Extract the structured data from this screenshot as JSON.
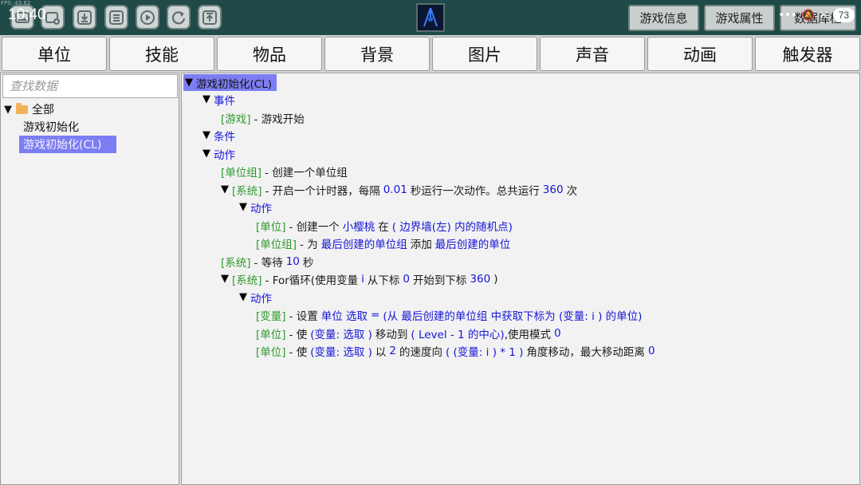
{
  "status": {
    "fps": "FPS: 43.82",
    "clock": "10:40",
    "battery": "73"
  },
  "toolbar": {
    "buttons": [
      "image-icon",
      "add-file-icon",
      "download-icon",
      "save-icon",
      "play-icon",
      "refresh-icon",
      "upload-icon"
    ],
    "pills": [
      "游戏信息",
      "游戏属性",
      "数据库检"
    ]
  },
  "tabs": [
    "单位",
    "技能",
    "物品",
    "背景",
    "图片",
    "声音",
    "动画",
    "触发器"
  ],
  "left": {
    "search_placeholder": "查找数据",
    "root_label": "全部",
    "items": [
      "游戏初始化",
      "游戏初始化(CL)"
    ]
  },
  "script": {
    "root": "游戏初始化(CL)",
    "events_header": "事件",
    "event": {
      "tag": "[游戏]",
      "text": "- 游戏开始"
    },
    "conditions_header": "条件",
    "actions_header": "动作",
    "a1": {
      "tag": "[单位组]",
      "text": "- 创建一个单位组"
    },
    "a2": {
      "tag": "[系统]",
      "t1": "- 开启一个计时器，每隔",
      "v1": "0.01",
      "t2": "秒运行一次动作。总共运行",
      "v2": "360",
      "t3": "次"
    },
    "a2_actions": "动作",
    "a2_1": {
      "tag": "[单位]",
      "t1": "- 创建一个",
      "v1": "小樱桃",
      "t2": "在",
      "v2": "( 边界墙(左) 内的随机点)"
    },
    "a2_2": {
      "tag": "[单位组]",
      "t1": "- 为",
      "v1": "最后创建的单位组",
      "t2": "添加",
      "v2": "最后创建的单位"
    },
    "a3": {
      "tag": "[系统]",
      "t1": "- 等待",
      "v1": "10",
      "t2": "秒"
    },
    "a4": {
      "tag": "[系统]",
      "t1": "- For循环(使用变量",
      "v1": "i",
      "t2": "从下标",
      "v2": "0",
      "t3": "开始到下标",
      "v3": "360",
      "t4": ")"
    },
    "a4_actions": "动作",
    "a4_1": {
      "tag": "[变量]",
      "t1": "- 设置",
      "v1": "单位  选取",
      "t2": "=",
      "v2": "(从 最后创建的单位组 中获取下标为 (变量: i ) 的单位)"
    },
    "a4_2": {
      "tag": "[单位]",
      "t1": "- 使",
      "v1": "(变量: 选取 )",
      "t2": "移动到",
      "v2": "( Level - 1 的中心)",
      "t3": ",使用模式",
      "v3": "0"
    },
    "a4_3": {
      "tag": "[单位]",
      "t1": "- 使",
      "v1": "(变量: 选取 )",
      "t2": "以",
      "v2": "2",
      "t3": "的速度向",
      "v3": "( (变量: i )  *  1 )",
      "t4": "角度移动，最大移动距离",
      "v4": "0"
    }
  },
  "colors": {
    "topbar": "#1f4a47",
    "selection": "#7d7df3",
    "value_blue": "#1515d8",
    "tag_green": "#2e9a2e"
  }
}
